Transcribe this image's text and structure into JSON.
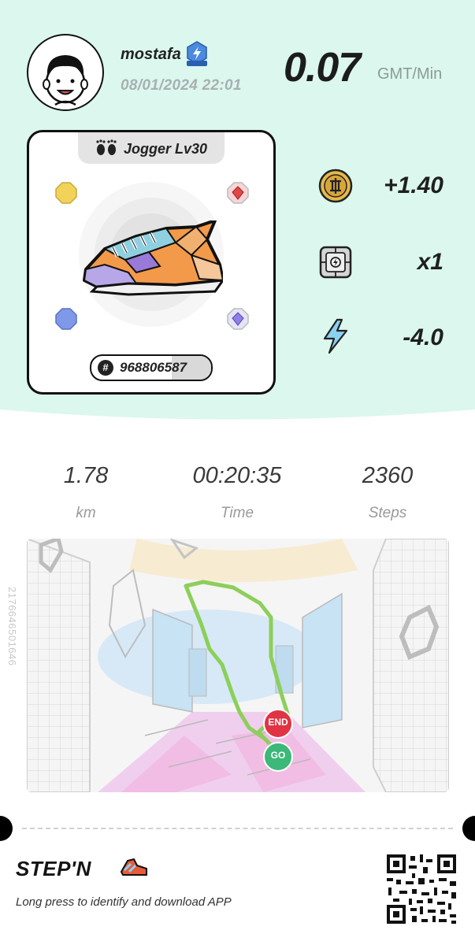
{
  "header": {
    "username": "mostafa",
    "datetime": "08/01/2024 22:01",
    "rate_value": "0.07",
    "rate_unit": "GMT/Min"
  },
  "sneaker_card": {
    "type_label": "Jogger Lv30",
    "id_number": "968806587"
  },
  "rewards": [
    {
      "icon": "gmt-coin-icon",
      "value": "+1.40"
    },
    {
      "icon": "mystery-box-icon",
      "value": "x1"
    },
    {
      "icon": "energy-bolt-icon",
      "value": "-4.0"
    }
  ],
  "metrics": [
    {
      "value": "1.78",
      "label": "km"
    },
    {
      "value": "00:20:35",
      "label": "Time"
    },
    {
      "value": "2360",
      "label": "Steps"
    }
  ],
  "map": {
    "side_code": "2176646501646",
    "end_label": "END",
    "go_label": "GO"
  },
  "footer": {
    "brand": "STEP'N",
    "hint": "Long press to identify and download APP"
  },
  "colors": {
    "top_bg": "#dbf7ee",
    "route": "#8ccf5a",
    "end_pin": "#e03343",
    "go_pin": "#3cb878"
  }
}
